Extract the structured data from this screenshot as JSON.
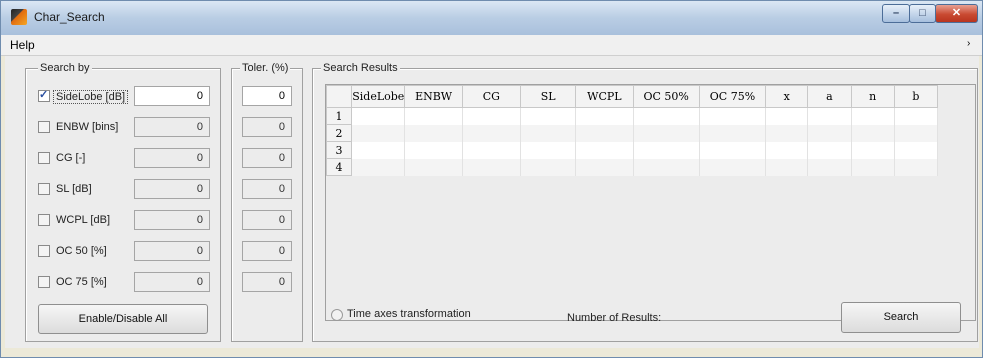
{
  "window": {
    "title": "Char_Search",
    "min_icon": "minimize-icon",
    "max_icon": "maximize-icon",
    "close_icon": "close-icon"
  },
  "menu": {
    "help": "Help",
    "arrow": "›"
  },
  "search_by": {
    "legend": "Search by",
    "items": [
      {
        "label": "SideLobe [dB]",
        "checked": true,
        "value": "0"
      },
      {
        "label": "ENBW [bins]",
        "checked": false,
        "value": "0"
      },
      {
        "label": "CG [-]",
        "checked": false,
        "value": "0"
      },
      {
        "label": "SL [dB]",
        "checked": false,
        "value": "0"
      },
      {
        "label": "WCPL [dB]",
        "checked": false,
        "value": "0"
      },
      {
        "label": "OC 50 [%]",
        "checked": false,
        "value": "0"
      },
      {
        "label": "OC 75 [%]",
        "checked": false,
        "value": "0"
      }
    ],
    "enable_disable_label": "Enable/Disable All"
  },
  "toler": {
    "legend": "Toler. (%)",
    "values": [
      "0",
      "0",
      "0",
      "0",
      "0",
      "0",
      "0"
    ]
  },
  "results": {
    "legend": "Search Results",
    "columns": [
      "SideLobe",
      "ENBW",
      "CG",
      "SL",
      "WCPL",
      "OC 50%",
      "OC 75%",
      "x",
      "a",
      "n",
      "b"
    ],
    "rows": [
      "1",
      "2",
      "3",
      "4"
    ]
  },
  "time_axes": {
    "label": "Time axes transformation",
    "selected": false
  },
  "number_of_results": {
    "label": "Number of Results:"
  },
  "search_button": {
    "label": "Search"
  }
}
